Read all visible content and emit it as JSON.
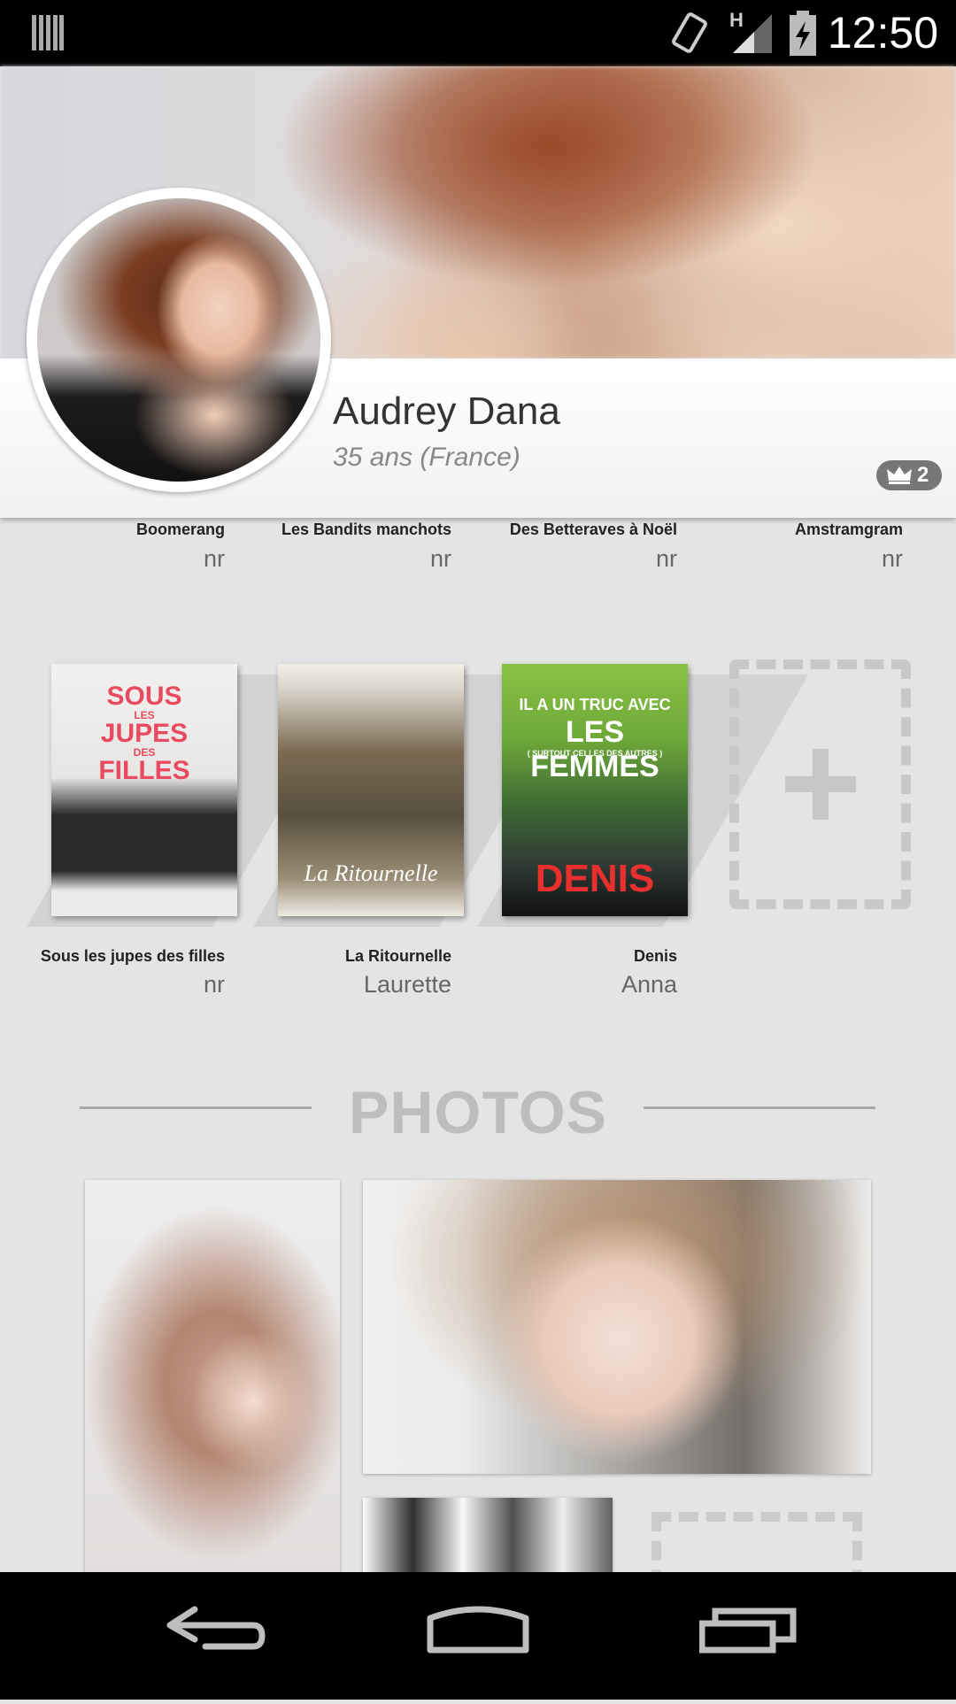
{
  "status_bar": {
    "time": "12:50",
    "network_label": "H",
    "icons": [
      "notifications-icon",
      "rotate-icon",
      "signal-icon",
      "battery-charging-icon"
    ]
  },
  "profile": {
    "name": "Audrey Dana",
    "age_country": "35 ans (France)",
    "rank_badge": "2",
    "rank_icon": "crown-icon"
  },
  "films_row_partial": [
    {
      "title": "Boomerang",
      "role": "nr"
    },
    {
      "title": "Les Bandits manchots",
      "role": "nr"
    },
    {
      "title": "Des Betteraves à Noël",
      "role": "nr"
    },
    {
      "title": "Amstramgram",
      "role": "nr"
    }
  ],
  "films_row": [
    {
      "title": "Sous les jupes des filles",
      "role": "nr",
      "poster_text": [
        "SOUS",
        "LES",
        "JUPES",
        "DES",
        "FILLES"
      ]
    },
    {
      "title": "La Ritournelle",
      "role": "Laurette",
      "poster_text": [
        "La Ritournelle"
      ]
    },
    {
      "title": "Denis",
      "role": "Anna",
      "poster_text": [
        "IL A UN TRUC AVEC",
        "LES FEMMES",
        "( SURTOUT CELLES DES AUTRES )",
        "DENIS"
      ]
    }
  ],
  "add_film_icon": "plus-icon",
  "photos_section": {
    "title": "PHOTOS",
    "add_photo_icon": "plus-icon"
  },
  "nav_bar": {
    "buttons": [
      "back-icon",
      "home-icon",
      "recents-icon"
    ]
  },
  "colors": {
    "background": "#e4e4e4",
    "badge": "#777777",
    "section_title": "#bdbdbd"
  }
}
